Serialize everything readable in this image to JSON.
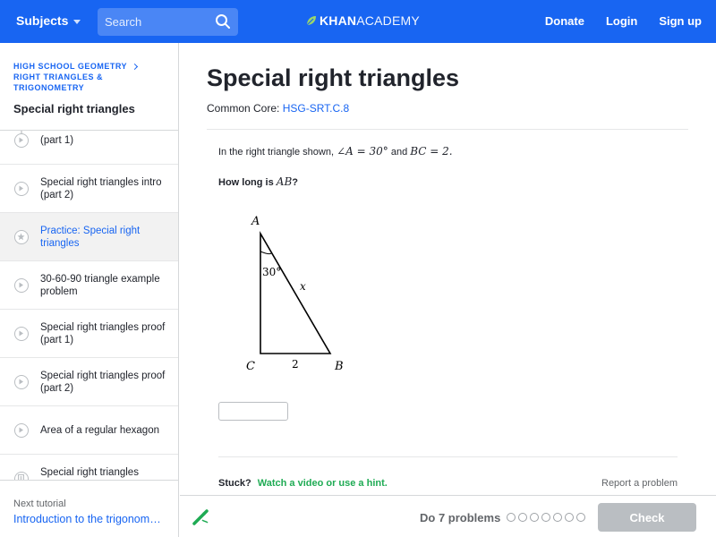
{
  "nav": {
    "subjects": "Subjects",
    "search_placeholder": "Search",
    "logo_khan": "KHAN",
    "logo_academy": "ACADEMY",
    "donate": "Donate",
    "login": "Login",
    "signup": "Sign up",
    "bg_color": "#1865f2"
  },
  "sidebar": {
    "breadcrumb_1": "HIGH SCHOOL GEOMETRY",
    "breadcrumb_2a": "RIGHT TRIANGLES &",
    "breadcrumb_2b": "TRIGONOMETRY",
    "tutorial_title": "Special right triangles",
    "items": [
      {
        "label": "(part 1)",
        "icon": "play-icon",
        "active": false
      },
      {
        "label": "Special right triangles intro (part 2)",
        "icon": "play-icon",
        "active": false
      },
      {
        "label": "Practice: Special right triangles",
        "icon": "star-icon",
        "active": true
      },
      {
        "label": "30-60-90 triangle example problem",
        "icon": "play-icon",
        "active": false
      },
      {
        "label": "Special right triangles proof (part 1)",
        "icon": "play-icon",
        "active": false
      },
      {
        "label": "Special right triangles proof (part 2)",
        "icon": "play-icon",
        "active": false
      },
      {
        "label": "Area of a regular hexagon",
        "icon": "play-icon",
        "active": false
      },
      {
        "label": "Special right triangles review",
        "icon": "article-icon",
        "active": false
      }
    ],
    "next_label": "Next tutorial",
    "next_link": "Introduction to the trigonometric ratios"
  },
  "main": {
    "title": "Special right triangles",
    "common_core_label": "Common Core:",
    "common_core_code": "HSG-SRT.C.8",
    "question_prefix": "In the right triangle shown,",
    "question_math_1": "∠A = 30°",
    "question_and": "and",
    "question_math_2": "BC = 2.",
    "how_prefix": "How long is",
    "how_math": "AB",
    "how_suffix": "?",
    "triangle": {
      "label_a": "A",
      "label_b": "B",
      "label_c": "C",
      "angle": "30°",
      "side_bc": "2",
      "side_ab": "x"
    },
    "stuck": "Stuck?",
    "stuck_link": "Watch a video or use a hint.",
    "report": "Report a problem"
  },
  "bottom": {
    "do_problems": "Do 7 problems",
    "problem_count": 7,
    "check": "Check"
  }
}
